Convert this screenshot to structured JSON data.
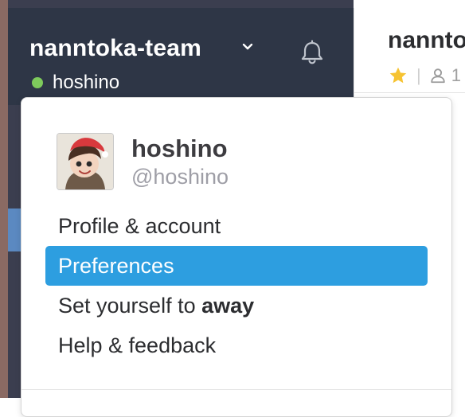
{
  "sidebar": {
    "team_name": "nanntoka-team",
    "user_name": "hoshino",
    "icons": {
      "chevron": "chevron-down-icon",
      "bell": "bell-icon",
      "presence": "presence-dot"
    },
    "colors": {
      "header_bg": "#2e3646",
      "presence": "#7ecb5c"
    }
  },
  "channel": {
    "title": "nannto",
    "meta_separator": "|",
    "member_count_partial": "1",
    "icons": {
      "star": "star-icon",
      "member": "person-icon"
    },
    "colors": {
      "star": "#f6c332"
    }
  },
  "menu": {
    "user": {
      "display_name": "hoshino",
      "handle": "@hoshino",
      "avatar_icon": "avatar-image"
    },
    "items": [
      {
        "label": "Profile & account"
      },
      {
        "label": "Preferences"
      },
      {
        "label_prefix": "Set yourself to ",
        "label_bold": "away"
      },
      {
        "label": "Help & feedback"
      }
    ],
    "colors": {
      "highlight": "#2d9ee0"
    }
  }
}
